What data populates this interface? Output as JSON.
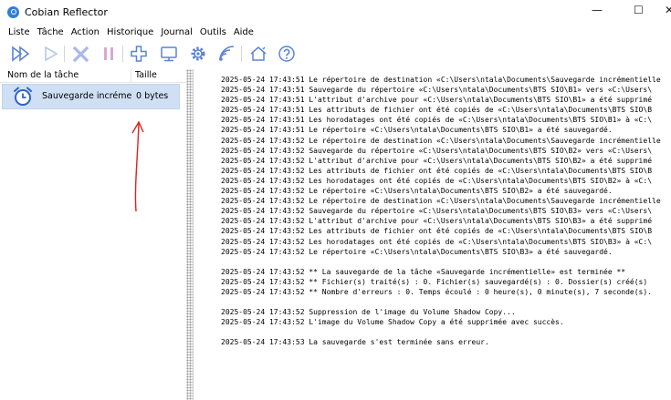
{
  "window": {
    "title": "Cobian Reflector",
    "minimize_glyph": "—",
    "maximize_glyph": "☐",
    "close_glyph": "✕"
  },
  "menu": [
    "Liste",
    "Tâche",
    "Action",
    "Historique",
    "Journal",
    "Outils",
    "Aide"
  ],
  "toolbar": {
    "icons": [
      "run-all-icon",
      "run-icon",
      "cancel-icon",
      "pause-icon",
      "add-task-icon",
      "computer-icon",
      "settings-icon",
      "shadow-copy-icon",
      "home-icon",
      "help-icon"
    ],
    "colors": {
      "accent": "#5a83d8",
      "disabled": "#b9c7ea",
      "cancel": "#a9b9ec",
      "pause": "#d9a8d0"
    }
  },
  "task_list": {
    "headers": {
      "name": "Nom de la tâche",
      "size": "Taille"
    },
    "rows": [
      {
        "name": "Sauvegarde incrémentielle",
        "size": "0 bytes"
      }
    ],
    "selection_color": "#cfe0f5"
  },
  "annotation": {
    "color": "#e02020"
  },
  "log": {
    "lines": [
      "2025-05-24 17:43:51 Le répertoire de destination «C:\\Users\\ntala\\Documents\\Sauvegarde incrémentielle",
      "2025-05-24 17:43:51 Sauvegarde du répertoire «C:\\Users\\ntala\\Documents\\BTS SIO\\B1» vers «C:\\Users\\",
      "2025-05-24 17:43:51 L'attribut d'archive pour «C:\\Users\\ntala\\Documents\\BTS SIO\\B1» a été supprimé",
      "2025-05-24 17:43:51 Les attributs de fichier ont été copiés de «C:\\Users\\ntala\\Documents\\BTS SIO\\B",
      "2025-05-24 17:43:51 Les horodatages ont été copiés de «C:\\Users\\ntala\\Documents\\BTS SIO\\B1» à «C:\\",
      "2025-05-24 17:43:51 Le répertoire «C:\\Users\\ntala\\Documents\\BTS SIO\\B1» a été sauvegardé.",
      "2025-05-24 17:43:52 Le répertoire de destination «C:\\Users\\ntala\\Documents\\Sauvegarde incrémentielle",
      "2025-05-24 17:43:52 Sauvegarde du répertoire «C:\\Users\\ntala\\Documents\\BTS SIO\\B2» vers «C:\\Users\\",
      "2025-05-24 17:43:52 L'attribut d'archive pour «C:\\Users\\ntala\\Documents\\BTS SIO\\B2» a été supprimé",
      "2025-05-24 17:43:52 Les attributs de fichier ont été copiés de «C:\\Users\\ntala\\Documents\\BTS SIO\\B",
      "2025-05-24 17:43:52 Les horodatages ont été copiés de «C:\\Users\\ntala\\Documents\\BTS SIO\\B2» à «C:\\",
      "2025-05-24 17:43:52 Le répertoire «C:\\Users\\ntala\\Documents\\BTS SIO\\B2» a été sauvegardé.",
      "2025-05-24 17:43:52 Le répertoire de destination «C:\\Users\\ntala\\Documents\\Sauvegarde incrémentielle",
      "2025-05-24 17:43:52 Sauvegarde du répertoire «C:\\Users\\ntala\\Documents\\BTS SIO\\B3» vers «C:\\Users\\",
      "2025-05-24 17:43:52 L'attribut d'archive pour «C:\\Users\\ntala\\Documents\\BTS SIO\\B3» a été supprimé",
      "2025-05-24 17:43:52 Les attributs de fichier ont été copiés de «C:\\Users\\ntala\\Documents\\BTS SIO\\B",
      "2025-05-24 17:43:52 Les horodatages ont été copiés de «C:\\Users\\ntala\\Documents\\BTS SIO\\B3» à «C:\\",
      "2025-05-24 17:43:52 Le répertoire «C:\\Users\\ntala\\Documents\\BTS SIO\\B3» a été sauvegardé.",
      "",
      "2025-05-24 17:43:52 ** La sauvegarde de la tâche «Sauvegarde incrémentielle» est terminée **",
      "2025-05-24 17:43:52 ** Fichier(s) traité(s) : 0. Fichier(s) sauvegardé(s) : 0. Dossier(s) créé(s)",
      "2025-05-24 17:43:52 ** Nombre d'erreurs : 0. Temps écoulé : 0 heure(s), 0 minute(s), 7 seconde(s).",
      "",
      "2025-05-24 17:43:52 Suppression de l'image du Volume Shadow Copy...",
      "2025-05-24 17:43:52 L'image du Volume Shadow Copy a été supprimée avec succès.",
      "",
      "2025-05-24 17:43:53 La sauvegarde s'est terminée sans erreur."
    ]
  }
}
